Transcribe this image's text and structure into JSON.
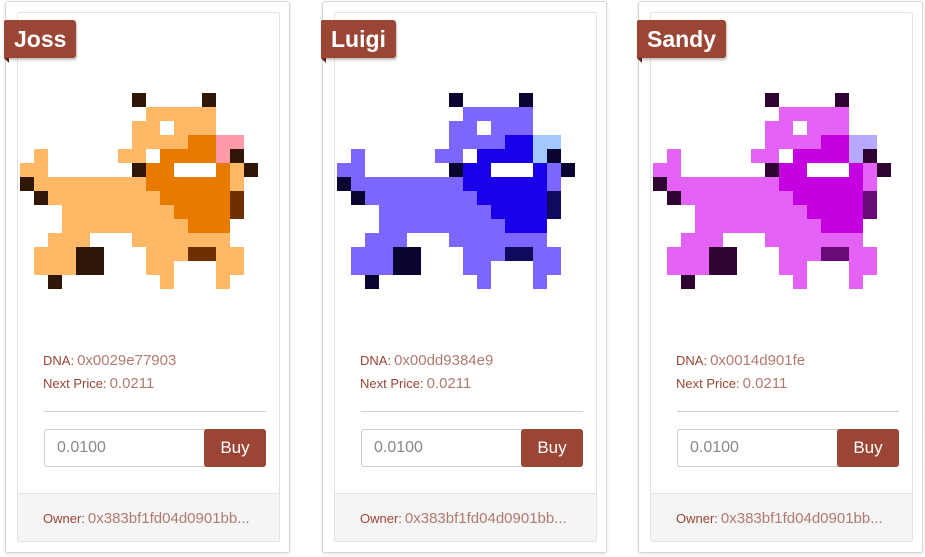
{
  "cards": [
    {
      "name": "Joss",
      "colors": {
        "body": "#ffb866",
        "dark": "#e87a00",
        "deeper": "#6e3000",
        "outline": "#2f1606",
        "nose": "#ff9aa8",
        "eye": "#ffffff"
      },
      "dna_label": "DNA:",
      "dna": "0x0029e77903",
      "price_label": "Next Price:",
      "price": "0.0211",
      "input_value": "0.0100",
      "buy_label": "Buy",
      "owner_label": "Owner:",
      "owner": "0x383bf1fd04d0901bb..."
    },
    {
      "name": "Luigi",
      "colors": {
        "body": "#7b66ff",
        "dark": "#1a00e8",
        "deeper": "#100a5c",
        "outline": "#0a0530",
        "nose": "#a3c8ff",
        "eye": "#ffffff"
      },
      "dna_label": "DNA:",
      "dna": "0x00dd9384e9",
      "price_label": "Next Price:",
      "price": "0.0211",
      "input_value": "0.0100",
      "buy_label": "Buy",
      "owner_label": "Owner:",
      "owner": "0x383bf1fd04d0901bb..."
    },
    {
      "name": "Sandy",
      "colors": {
        "body": "#e462f5",
        "dark": "#c400e0",
        "deeper": "#6a0a78",
        "outline": "#2e0530",
        "nose": "#b8a8ff",
        "eye": "#ffffff"
      },
      "dna_label": "DNA:",
      "dna": "0x0014d901fe",
      "price_label": "Next Price:",
      "price": "0.0211",
      "input_value": "0.0100",
      "buy_label": "Buy",
      "owner_label": "Owner:",
      "owner": "0x383bf1fd04d0901bb..."
    }
  ]
}
